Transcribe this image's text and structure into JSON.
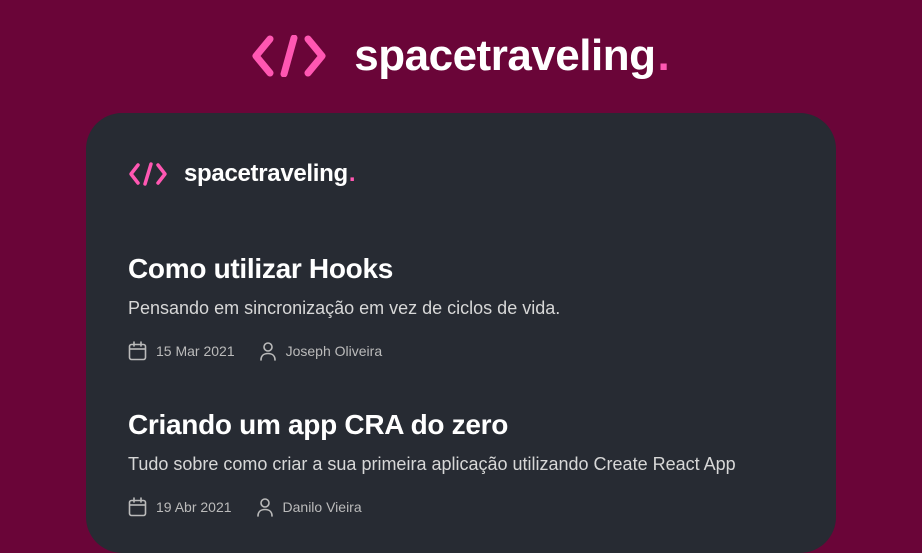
{
  "brand": {
    "name": "spacetraveling",
    "dot": ".",
    "accent_color": "#ff57b2",
    "background_color": "#6a0538",
    "card_color": "#272b33"
  },
  "card_header": {
    "name": "spacetraveling",
    "dot": "."
  },
  "posts": [
    {
      "title": "Como utilizar Hooks",
      "subtitle": "Pensando em sincronização em vez de ciclos de vida.",
      "date": "15 Mar 2021",
      "author": "Joseph Oliveira",
      "date_icon": "calendar-icon",
      "author_icon": "user-icon"
    },
    {
      "title": "Criando um app CRA do zero",
      "subtitle": "Tudo sobre como criar a sua primeira aplicação utilizando Create React App",
      "date": "19 Abr 2021",
      "author": "Danilo Vieira",
      "date_icon": "calendar-icon",
      "author_icon": "user-icon"
    }
  ]
}
